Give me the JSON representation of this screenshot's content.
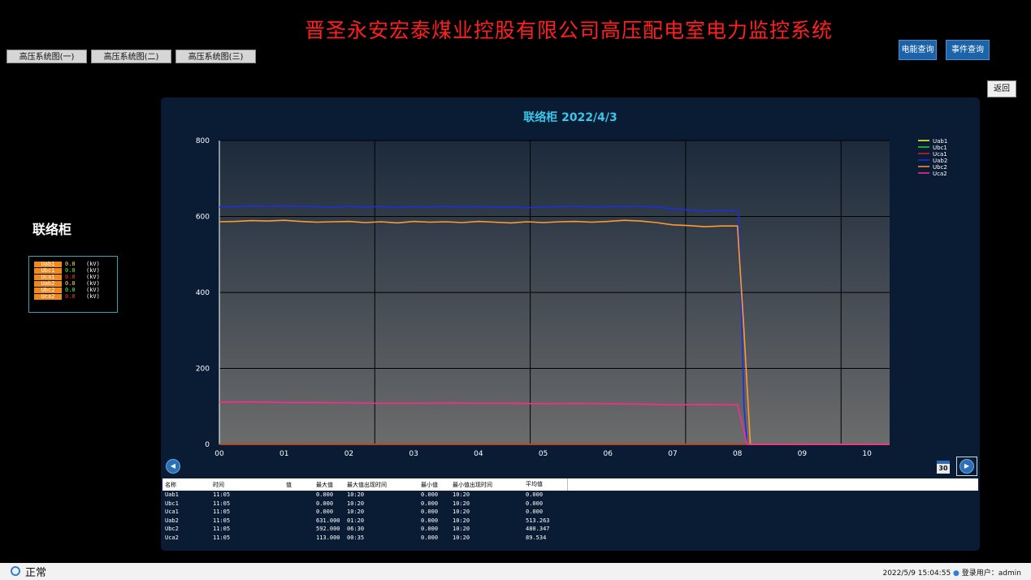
{
  "header": {
    "title": "晋圣永安宏泰煤业控股有限公司高压配电室电力监控系统"
  },
  "nav": [
    {
      "label": "高压系统图(一)"
    },
    {
      "label": "高压系统图(二)"
    },
    {
      "label": "高压系统图(三)"
    }
  ],
  "query_buttons": {
    "energy": "电能查询",
    "event": "事件查询"
  },
  "back_label": "返回",
  "panel": {
    "name": "联络柜",
    "readings": [
      {
        "name": "Uab1",
        "value": "0.0",
        "unit": "(kV)",
        "color": "#ffe14d"
      },
      {
        "name": "Ubc1",
        "value": "0.0",
        "unit": "(kV)",
        "color": "#4cff4c"
      },
      {
        "name": "Uca1",
        "value": "0.0",
        "unit": "(kV)",
        "color": "#ff3030"
      },
      {
        "name": "Uab2",
        "value": "0.0",
        "unit": "(kV)",
        "color": "#ffe14d"
      },
      {
        "name": "Ubc2",
        "value": "0.0",
        "unit": "(kV)",
        "color": "#4cff4c"
      },
      {
        "name": "Uca2",
        "value": "0.0",
        "unit": "(kV)",
        "color": "#ff3030"
      }
    ]
  },
  "chart_data": {
    "type": "line",
    "title": "联络柜 2022/4/3",
    "x_ticks": [
      "00",
      "01",
      "02",
      "03",
      "04",
      "05",
      "06",
      "07",
      "08",
      "09",
      "10"
    ],
    "y_ticks": [
      "0",
      "200",
      "400",
      "600",
      "800"
    ],
    "xlim": [
      0,
      10.35
    ],
    "ylim": [
      0,
      800
    ],
    "grid": true,
    "legend_position": "top-right",
    "series": [
      {
        "name": "Uab1",
        "color": "#ffff33",
        "x": [
          0,
          10.35
        ],
        "y": [
          0,
          0
        ]
      },
      {
        "name": "Ubc1",
        "color": "#33cc33",
        "x": [
          0,
          10.35
        ],
        "y": [
          0,
          0
        ]
      },
      {
        "name": "Uca1",
        "color": "#cc2222",
        "x": [
          0,
          10.35
        ],
        "y": [
          0,
          0
        ]
      },
      {
        "name": "Uab2",
        "color": "#1e2fd8",
        "x": [
          0,
          0.25,
          0.5,
          0.75,
          1.0,
          1.25,
          1.5,
          1.75,
          2.0,
          2.25,
          2.5,
          2.75,
          3.0,
          3.25,
          3.5,
          3.75,
          4.0,
          4.25,
          4.5,
          4.75,
          5.0,
          5.25,
          5.5,
          5.75,
          6.0,
          6.25,
          6.5,
          6.75,
          7.0,
          7.25,
          7.5,
          7.75,
          8.0,
          8.02,
          8.07,
          8.1,
          8.15,
          10.35
        ],
        "y": [
          625,
          626,
          628,
          627,
          628,
          627,
          626,
          624,
          627,
          625,
          626,
          624,
          626,
          625,
          627,
          625,
          626,
          624,
          625,
          623,
          625,
          626,
          627,
          625,
          626,
          626,
          627,
          625,
          620,
          617,
          614,
          616,
          615,
          600,
          300,
          100,
          0,
          0
        ]
      },
      {
        "name": "Ubc2",
        "color": "#ff9a2e",
        "x": [
          0,
          0.25,
          0.5,
          0.75,
          1.0,
          1.25,
          1.5,
          1.75,
          2.0,
          2.25,
          2.5,
          2.75,
          3.0,
          3.25,
          3.5,
          3.75,
          4.0,
          4.25,
          4.5,
          4.75,
          5.0,
          5.25,
          5.5,
          5.75,
          6.0,
          6.25,
          6.5,
          6.75,
          7.0,
          7.25,
          7.5,
          7.75,
          8.0,
          8.1,
          8.2,
          10.35
        ],
        "y": [
          586,
          587,
          589,
          588,
          590,
          587,
          585,
          586,
          587,
          584,
          586,
          583,
          587,
          585,
          586,
          584,
          587,
          585,
          583,
          586,
          584,
          586,
          587,
          585,
          587,
          590,
          588,
          584,
          578,
          576,
          573,
          575,
          575,
          300,
          0,
          0
        ]
      },
      {
        "name": "Uca2",
        "color": "#ff2a8c",
        "x": [
          0,
          0.5,
          1.0,
          1.5,
          2.0,
          2.5,
          3.0,
          3.5,
          4.0,
          4.5,
          5.0,
          5.5,
          6.0,
          6.5,
          7.0,
          7.5,
          8.0,
          8.15,
          10.35
        ],
        "y": [
          111,
          112,
          110,
          110,
          109,
          108,
          108,
          109,
          108,
          108,
          107,
          108,
          107,
          106,
          104,
          105,
          104,
          0,
          0
        ]
      }
    ]
  },
  "table": {
    "headers": [
      "名称",
      "时间",
      "值",
      "最大值",
      "最大值出现时间",
      "最小值",
      "最小值出现时间",
      "平均值"
    ],
    "rows": [
      [
        "Uab1",
        "11:05",
        "",
        "0.000",
        "10:20",
        "0.000",
        "10:20",
        "0.000"
      ],
      [
        "Ubc1",
        "11:05",
        "",
        "0.000",
        "10:20",
        "0.000",
        "10:20",
        "0.000"
      ],
      [
        "Uca1",
        "11:05",
        "",
        "0.000",
        "10:20",
        "0.000",
        "10:20",
        "0.000"
      ],
      [
        "Uab2",
        "11:05",
        "",
        "631.000",
        "01:20",
        "0.000",
        "10:20",
        "513.263"
      ],
      [
        "Ubc2",
        "11:05",
        "",
        "592.000",
        "06:30",
        "0.000",
        "10:20",
        "480.347"
      ],
      [
        "Uca2",
        "11:05",
        "",
        "113.000",
        "00:35",
        "0.000",
        "10:20",
        "89.534"
      ]
    ]
  },
  "calendar_icon_text": "30",
  "status": {
    "text": "正常",
    "datetime": "2022/5/9 15:04:55",
    "user_label": "登录用户：",
    "user": "admin"
  }
}
